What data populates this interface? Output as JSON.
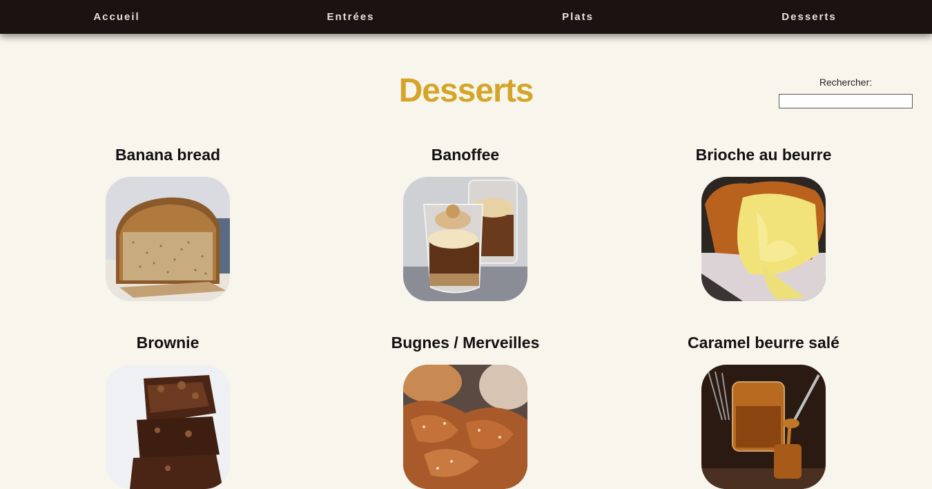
{
  "nav": {
    "items": [
      {
        "label": "Accueil"
      },
      {
        "label": "Entrées"
      },
      {
        "label": "Plats"
      },
      {
        "label": "Desserts"
      }
    ]
  },
  "page": {
    "title": "Desserts"
  },
  "search": {
    "label": "Rechercher:",
    "value": ""
  },
  "recipes": [
    {
      "title": "Banana bread",
      "image": "banana-bread-photo"
    },
    {
      "title": "Banoffee",
      "image": "banoffee-photo"
    },
    {
      "title": "Brioche au beurre",
      "image": "brioche-photo"
    },
    {
      "title": "Brownie",
      "image": "brownie-photo"
    },
    {
      "title": "Bugnes / Merveilles",
      "image": "bugnes-photo"
    },
    {
      "title": "Caramel beurre salé",
      "image": "caramel-photo"
    }
  ]
}
